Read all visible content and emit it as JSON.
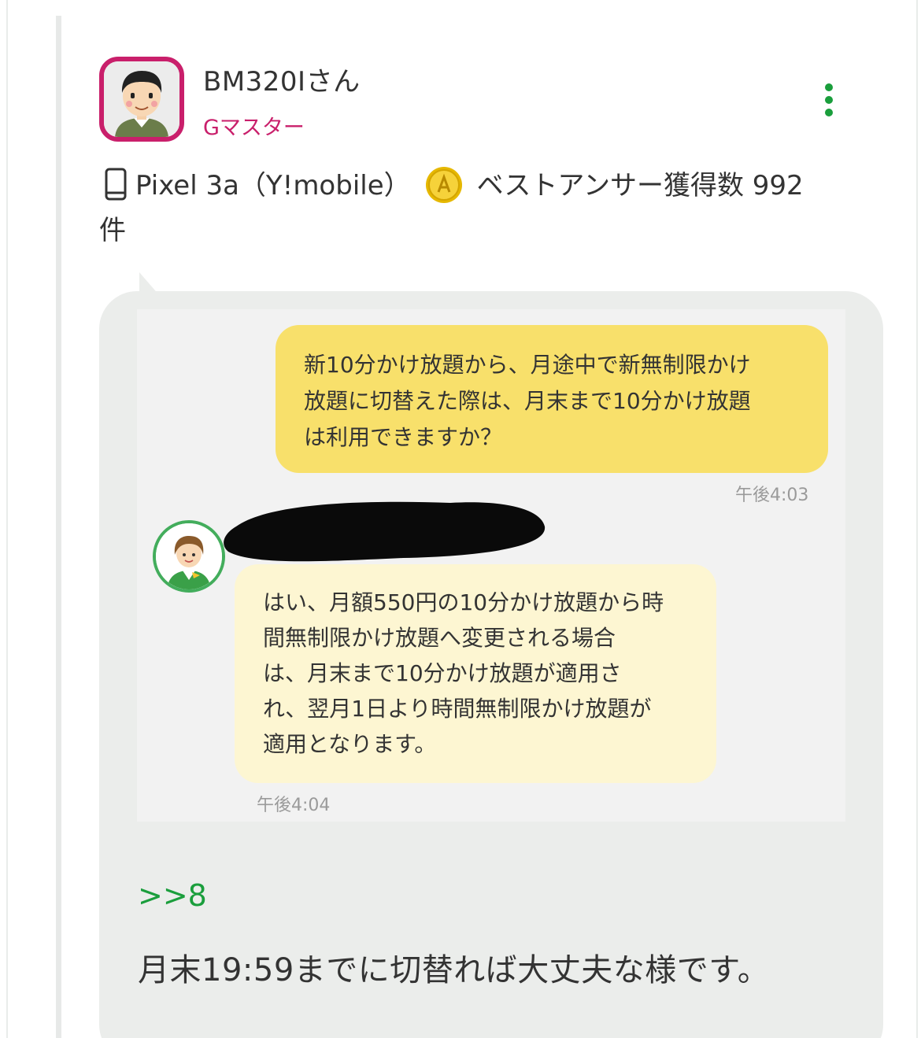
{
  "post": {
    "author_name": "BM320Iさん",
    "author_rank": "Gマスター",
    "device_prefix": "Pixel 3a（Y!mobile）",
    "best_answer_text": "ベストアンサー獲得数 992",
    "best_answer_suffix": "件",
    "reply_ref": ">>8",
    "reply_text": "月末19:59までに切替れば大丈夫な様です。"
  },
  "chat": {
    "user_message_lines": [
      "新10分かけ放題から、月途中で新無制限かけ",
      "放題に切替えた際は、月末まで10分かけ放題",
      "は利用できますか？"
    ],
    "user_time": "午後4:03",
    "agent_message_lines": [
      "はい、月額550円の10分かけ放題から時",
      "間無制限かけ放題へ変更される場合",
      "は、月末まで10分かけ放題が適用さ",
      "れ、翌月1日より時間無制限かけ放題が",
      "適用となります。"
    ],
    "agent_time": "午後4:04"
  },
  "colors": {
    "rank": "#c91f6b",
    "accent_green": "#1a9e3c",
    "user_bubble": "#f8e06b",
    "agent_bubble": "#fdf6d2",
    "post_bubble": "#ebedeb"
  },
  "icons": {
    "menu": "kebab-menu-icon",
    "device": "smartphone-icon",
    "badge": "gold-coin-icon"
  }
}
